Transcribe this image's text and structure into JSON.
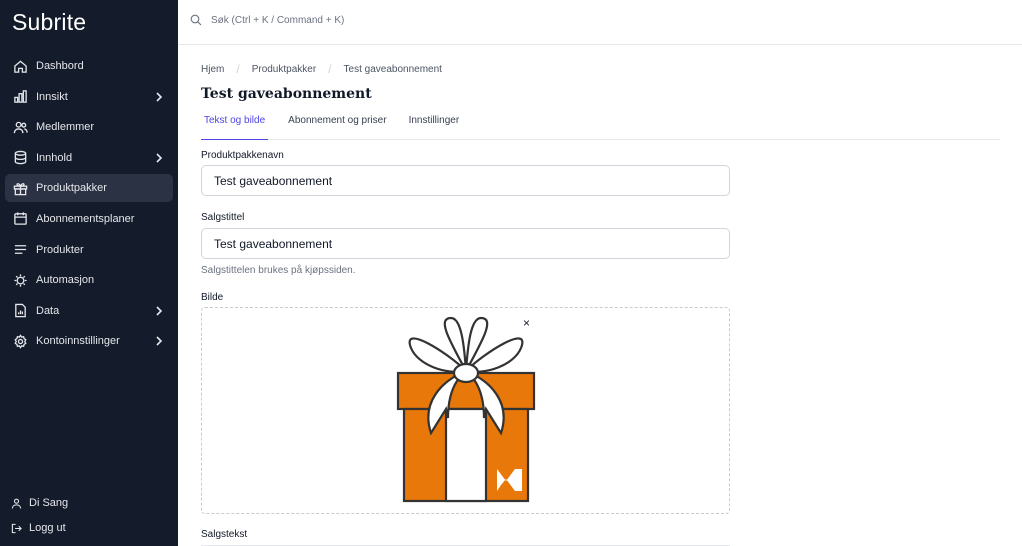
{
  "app": {
    "logo": "Subrite"
  },
  "sidebar": {
    "items": [
      {
        "label": "Dashbord",
        "icon": "home-icon",
        "chevron": false
      },
      {
        "label": "Innsikt",
        "icon": "bar-chart-icon",
        "chevron": true
      },
      {
        "label": "Medlemmer",
        "icon": "users-icon",
        "chevron": false
      },
      {
        "label": "Innhold",
        "icon": "database-icon",
        "chevron": true
      },
      {
        "label": "Produktpakker",
        "icon": "gift-icon",
        "chevron": false,
        "active": true
      },
      {
        "label": "Abonnementsplaner",
        "icon": "calendar-icon",
        "chevron": false
      },
      {
        "label": "Produkter",
        "icon": "list-icon",
        "chevron": false
      },
      {
        "label": "Automasjon",
        "icon": "automation-icon",
        "chevron": false
      },
      {
        "label": "Data",
        "icon": "file-chart-icon",
        "chevron": true
      },
      {
        "label": "Kontoinnstillinger",
        "icon": "gear-icon",
        "chevron": true
      }
    ],
    "footer": {
      "user": "Di Sang",
      "logout": "Logg ut"
    }
  },
  "search": {
    "placeholder": "Søk (Ctrl + K / Command + K)"
  },
  "breadcrumb": {
    "home": "Hjem",
    "section": "Produktpakker",
    "current": "Test gaveabonnement"
  },
  "page": {
    "title": "Test gaveabonnement"
  },
  "tabs": [
    {
      "label": "Tekst og bilde",
      "active": true
    },
    {
      "label": "Abonnement og priser",
      "active": false
    },
    {
      "label": "Innstillinger",
      "active": false
    }
  ],
  "form": {
    "name_label": "Produktpakkenavn",
    "name_value": "Test gaveabonnement",
    "sales_title_label": "Salgstittel",
    "sales_title_value": "Test gaveabonnement",
    "sales_title_help": "Salgstittelen brukes på kjøpssiden.",
    "image_label": "Bilde",
    "image_remove": "×",
    "sales_text_label": "Salgstekst"
  },
  "colors": {
    "sidebar_bg": "#141b2b",
    "accent": "#4f46e5",
    "gift_orange": "#e8780a"
  }
}
